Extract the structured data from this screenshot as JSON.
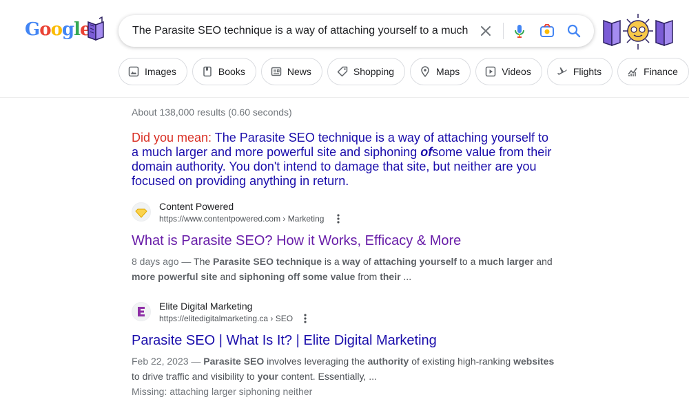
{
  "search": {
    "query": "The Parasite SEO technique is a way of attaching yourself to a much",
    "logo_text": "Google"
  },
  "chips": [
    {
      "label": "Images",
      "icon": "image-icon"
    },
    {
      "label": "Books",
      "icon": "book-icon"
    },
    {
      "label": "News",
      "icon": "news-icon"
    },
    {
      "label": "Shopping",
      "icon": "tag-icon"
    },
    {
      "label": "Maps",
      "icon": "map-pin-icon"
    },
    {
      "label": "Videos",
      "icon": "video-icon"
    },
    {
      "label": "Flights",
      "icon": "airplane-icon"
    },
    {
      "label": "Finance",
      "icon": "finance-chart-icon"
    }
  ],
  "results_meta": {
    "stats": "About 138,000 results (0.60 seconds)"
  },
  "did_you_mean": {
    "label": "Did you mean:",
    "before": "The Parasite SEO technique is a way of attaching yourself to a much larger and more powerful site and siphoning ",
    "emphasis": "of",
    "after": "some value from their domain authority. You don't intend to damage that site, but neither are you focused on providing anything in return."
  },
  "results": [
    {
      "site_name": "Content Powered",
      "url": "https://www.contentpowered.com › Marketing",
      "title": "What is Parasite SEO? How it Works, Efficacy & More",
      "snippet_parts": [
        {
          "t": "8 days ago — ",
          "k": "date"
        },
        {
          "t": "The ",
          "k": "n"
        },
        {
          "t": "Parasite SEO technique",
          "k": "b"
        },
        {
          "t": " is a ",
          "k": "n"
        },
        {
          "t": "way",
          "k": "b"
        },
        {
          "t": " of ",
          "k": "n"
        },
        {
          "t": "attaching yourself",
          "k": "b"
        },
        {
          "t": " to a ",
          "k": "n"
        },
        {
          "t": "much larger",
          "k": "b"
        },
        {
          "t": " and ",
          "k": "n"
        },
        {
          "t": "more powerful site",
          "k": "b"
        },
        {
          "t": " and ",
          "k": "n"
        },
        {
          "t": "siphoning off some value",
          "k": "b"
        },
        {
          "t": " from ",
          "k": "n"
        },
        {
          "t": "their",
          "k": "b"
        },
        {
          "t": " ...",
          "k": "n"
        }
      ]
    },
    {
      "site_name": "Elite Digital Marketing",
      "url": "https://elitedigitalmarketing.ca › SEO",
      "title": "Parasite SEO | What Is It? | Elite Digital Marketing",
      "snippet_parts": [
        {
          "t": "Feb 22, 2023 — ",
          "k": "date"
        },
        {
          "t": "Parasite SEO",
          "k": "b"
        },
        {
          "t": " involves leveraging the ",
          "k": "n"
        },
        {
          "t": "authority",
          "k": "b"
        },
        {
          "t": " of existing high-ranking ",
          "k": "n"
        },
        {
          "t": "websites",
          "k": "b"
        },
        {
          "t": " to drive traffic and visibility to ",
          "k": "n"
        },
        {
          "t": "your",
          "k": "b"
        },
        {
          "t": " content. Essentially, ...",
          "k": "n"
        }
      ],
      "missing_line": "Missing: attaching larger siphoning neither"
    }
  ],
  "colors": {
    "link_visited": "#681da8",
    "link": "#1a0dab",
    "did_you_mean_label": "#d93025"
  }
}
